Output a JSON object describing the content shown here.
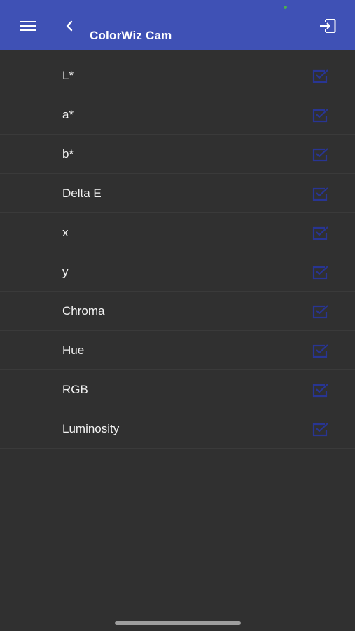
{
  "app": {
    "title": "ColorWiz Cam"
  },
  "header": {
    "menu_icon": "hamburger-menu-icon",
    "back_icon": "chevron-left-icon",
    "exit_icon": "logout-icon"
  },
  "colors": {
    "appbar": "#3f51b5",
    "background": "#303030",
    "checkbox": "#283593",
    "text": "#f2f2f2"
  },
  "options": [
    {
      "label": "L*",
      "checked": true
    },
    {
      "label": "a*",
      "checked": true
    },
    {
      "label": "b*",
      "checked": true
    },
    {
      "label": "Delta E",
      "checked": true
    },
    {
      "label": "x",
      "checked": true
    },
    {
      "label": "y",
      "checked": true
    },
    {
      "label": "Chroma",
      "checked": true
    },
    {
      "label": "Hue",
      "checked": true
    },
    {
      "label": "RGB",
      "checked": true
    },
    {
      "label": "Luminosity",
      "checked": true
    }
  ]
}
